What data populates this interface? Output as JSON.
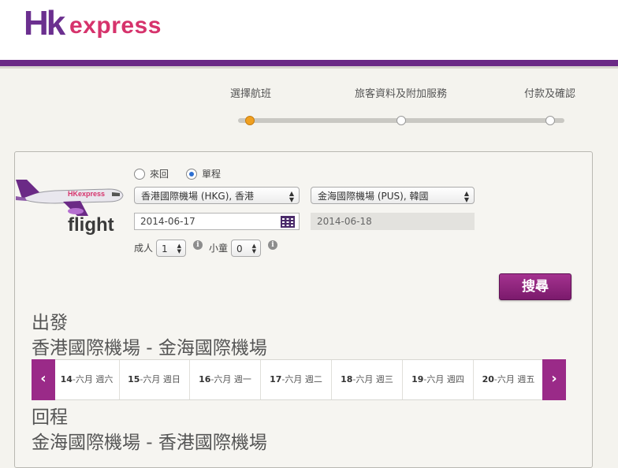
{
  "header": {
    "logo_hk": "Hk",
    "logo_express": "express",
    "brand_purple": "#6b2a86",
    "brand_pink": "#d6336c"
  },
  "steps": [
    {
      "label": "選擇航班",
      "active": true
    },
    {
      "label": "旅客資料及附加服務",
      "active": false
    },
    {
      "label": "付款及確認",
      "active": false
    }
  ],
  "search": {
    "flight_word": "flight",
    "trip_type": {
      "options": [
        {
          "label": "來回",
          "checked": false
        },
        {
          "label": "單程",
          "checked": true
        }
      ]
    },
    "origin": "香港國際機場 (HKG), 香港",
    "destination": "金海國際機場 (PUS), 韓國",
    "depart_date": "2014-06-17",
    "return_date": "2014-06-18",
    "adults_label": "成人",
    "adults_value": "1",
    "children_label": "小童",
    "children_value": "0",
    "search_button": "搜尋"
  },
  "outbound": {
    "heading": "出發",
    "route": "香港國際機場 - 金海國際機場",
    "dates": [
      {
        "day": "14",
        "rest": "-六月 週六"
      },
      {
        "day": "15",
        "rest": "-六月 週日"
      },
      {
        "day": "16",
        "rest": "-六月 週一"
      },
      {
        "day": "17",
        "rest": "-六月 週二"
      },
      {
        "day": "18",
        "rest": "-六月 週三"
      },
      {
        "day": "19",
        "rest": "-六月 週四"
      },
      {
        "day": "20",
        "rest": "-六月 週五"
      }
    ],
    "prev_arrow": "‹",
    "next_arrow": "›"
  },
  "inbound": {
    "heading": "回程",
    "route": "金海國際機場 - 香港國際機場"
  }
}
